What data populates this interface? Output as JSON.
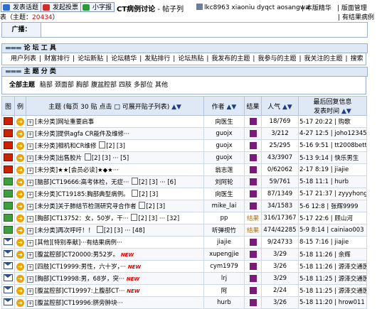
{
  "topbar": {
    "btn_post": "发表话题",
    "btn_vote": "发起投票",
    "btn_font": "小字报",
    "forum_name": "CT病例讨论",
    "sep": " - 帖子列",
    "users": "lkc8963 xiaoniu dyqct aosangwa",
    "link_essence": "本版精华",
    "link_admin": "版面管理",
    "link_results": "有结果病例",
    "line2_prefix": "表（主题：",
    "line2_count": "20434",
    "line2_suffix": "）"
  },
  "announce": {
    "label": "广播："
  },
  "tools_section": {
    "title": "论 坛 工 具",
    "items": [
      "用户列表",
      "财富排行",
      "论坛新贴",
      "论坛精华",
      "发贴排行",
      "论坛热贴",
      "我发布的主题",
      "我参与的主题",
      "我关注的主题",
      "搜索"
    ]
  },
  "category_section": {
    "title": "主 题 分 类",
    "all_label": "全部主题",
    "items": [
      "脑部",
      "颈面部",
      "胸部",
      "腹盆腔部",
      "四肢",
      "多部位",
      "其他"
    ]
  },
  "table": {
    "headers": {
      "icon": "图",
      "example": "例",
      "topic": "主题 (每页 30 贴 点击 □ 可展开贴子列表)",
      "author": "作者",
      "result": "结果",
      "hits": "人气",
      "last_top": "最后回复信息",
      "last_bottom": "发表时间"
    },
    "rows": [
      {
        "icon": "hot",
        "title": "[未分类]网址重要启事",
        "pages": "",
        "author": "向医生",
        "res": "box",
        "hits": "18/769",
        "last": "5-17 20:22 | 购歌"
      },
      {
        "icon": "hot",
        "title": "[未分类]提供agfa CR能件及维修···",
        "pages": "",
        "author": "guojx",
        "res": "box",
        "hits": "3/212",
        "last": "4-27 12:5 | joho123456"
      },
      {
        "icon": "hot",
        "title": "[未分类]相机和CR维修",
        "pages": "[2] [3]",
        "author": "guojx",
        "res": "box",
        "hits": "25/295",
        "last": "5-16 9:51 | tt2008betty"
      },
      {
        "icon": "hot",
        "title": "[未分类]出售胶片",
        "pages": "[2] [3] ··· [5]",
        "author": "guojx",
        "res": "box",
        "hits": "43/3907",
        "last": "5-13 9:14 | 快乐男生"
      },
      {
        "icon": "hot",
        "title": "[未分类]★★[会员必读]★◆★···",
        "pages": "",
        "author": "翁志莲",
        "res": "box",
        "hits": "0/62062",
        "last": "2-17 8:19 | jiajie"
      },
      {
        "icon": "green",
        "title": "[脑部]CT19666:高考体检，无症···",
        "pages": "[2] [3] ··· [6]",
        "author": "刘阿轮",
        "res": "box",
        "hits": "59/761",
        "last": "5-18 11:1 | hurb"
      },
      {
        "icon": "green",
        "title": "[未分类]CT19185:胸部典型病例。",
        "pages": "[2] [3]",
        "author": "向医生",
        "res": "box",
        "hits": "87/1349",
        "last": "5-17 21:37 | zyyyhong"
      },
      {
        "icon": "green",
        "title": "[未分类]关于肺结节检测研究寻合作者",
        "pages": "[2] [3]",
        "author": "mike_lai",
        "res": "box",
        "hits": "34/1583",
        "last": "5-6 12:8 | 张辉9999"
      },
      {
        "icon": "green",
        "title": "[胸部]CT13752：女，50岁，干···",
        "pages": "[2] [3] ··· [32]",
        "author": "pp",
        "res": "txt",
        "hits": "316/17367",
        "last": "5-17 22:6 | 顾山河"
      },
      {
        "icon": "green",
        "title": "[未分类]再次呼吁！！",
        "pages": "[2] [3] ··· [48]",
        "author": "听弹视竹",
        "res": "txt",
        "hits": "474/42285",
        "last": "5-9 8:14 | cainiao003"
      },
      {
        "icon": "mail",
        "title": "[其他][特别奉献]···有结果病例···",
        "pages": "",
        "author": "jiajie",
        "res": "box",
        "hits": "9/24733",
        "last": "8-15 7:16 | jiajie"
      },
      {
        "icon": "mail",
        "title": "[腹盆腔部]CT20000:男52岁。",
        "pages": "NEW",
        "author": "xupengjie",
        "res": "box",
        "hits": "3/29",
        "last": "5-18 11:26 | 余辉"
      },
      {
        "icon": "mail",
        "title": "[四肢]CT19999:男性，六十岁，···",
        "pages": "NEW",
        "author": "cym1979",
        "res": "box",
        "hits": "3/26",
        "last": "5-18 11:26 | 源泽交通医院"
      },
      {
        "icon": "mail",
        "title": "[胸部]CT19998:男，68岁，突···",
        "pages": "NEW",
        "author": "lrj",
        "res": "box",
        "hits": "3/29",
        "last": "5-18 11:25 | 源泽交通医院"
      },
      {
        "icon": "mail",
        "title": "[腹盆腔部]CT19997:上腹部CT···",
        "pages": "NEW",
        "author": "阿",
        "res": "box",
        "hits": "2/24",
        "last": "5-18 11:25 | 源泽交通医院"
      },
      {
        "icon": "mail",
        "title": "[腹盆腔部]CT19996:脐旁肿块···",
        "pages": "",
        "author": "hurb",
        "res": "box",
        "hits": "3/26",
        "last": "5-18 11:20 | hrow011"
      }
    ]
  }
}
